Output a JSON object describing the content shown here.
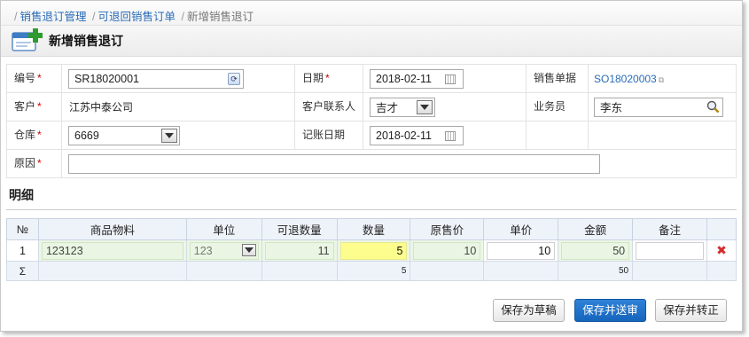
{
  "breadcrumb": {
    "root": "销售退订管理",
    "mid": "可退回销售订单",
    "current": "新增销售退订"
  },
  "page_title": "新增销售退订",
  "form": {
    "code_label": "编号",
    "code_value": "SR18020001",
    "date_label": "日期",
    "date_value": "2018-02-11",
    "sales_doc_label": "销售单据",
    "sales_doc_value": "SO18020003",
    "customer_label": "客户",
    "customer_value": "江苏中泰公司",
    "contact_label": "客户联系人",
    "contact_value": "吉才",
    "salesman_label": "业务员",
    "salesman_value": "李东",
    "warehouse_label": "仓库",
    "warehouse_value": "6669",
    "post_date_label": "记账日期",
    "post_date_value": "2018-02-11",
    "reason_label": "原因",
    "reason_value": ""
  },
  "detail_section": "明细",
  "grid": {
    "headers": [
      "№",
      "商品物料",
      "单位",
      "可退数量",
      "数量",
      "原售价",
      "单价",
      "金额",
      "备注"
    ],
    "row": {
      "no": "1",
      "item": "123123",
      "unit": "123",
      "returnable": "11",
      "qty": "5",
      "orig_price": "10",
      "price": "10",
      "amount": "50",
      "remark": ""
    },
    "sum": {
      "symbol": "Σ",
      "qty": "5",
      "amount": "50"
    }
  },
  "buttons": {
    "draft": "保存为草稿",
    "submit": "保存并送审",
    "transfer": "保存并转正"
  },
  "colors": {
    "primary": "#1565bd",
    "required": "#d40000",
    "highlight": "#fdfd8e",
    "delete": "#d42b2b"
  }
}
